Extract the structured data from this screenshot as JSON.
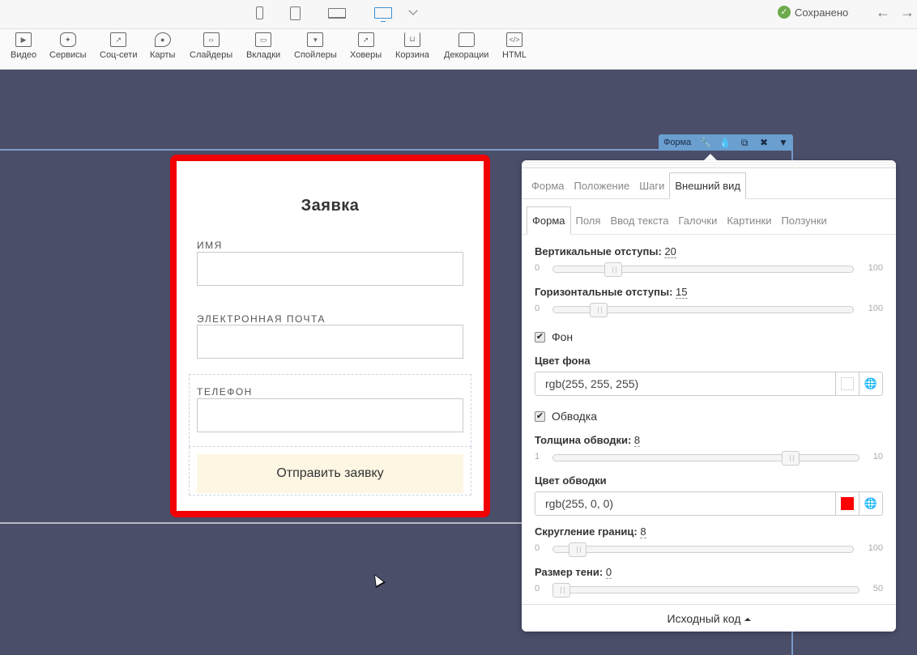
{
  "topbar": {
    "devices": [
      "phone-icon",
      "tablet-icon",
      "laptop-icon",
      "desktop-icon"
    ],
    "active_device": "desktop",
    "saved_label": "Сохранено",
    "accent_color": "#3b8fd6"
  },
  "toolbar": {
    "items": [
      {
        "label": "Видео",
        "icon": "play-icon"
      },
      {
        "label": "Сервисы",
        "icon": "puzzle-icon"
      },
      {
        "label": "Соц-сети",
        "icon": "share-icon"
      },
      {
        "label": "Карты",
        "icon": "map-pin-icon"
      },
      {
        "label": "Слайдеры",
        "icon": "slider-icon"
      },
      {
        "label": "Вкладки",
        "icon": "tabs-icon"
      },
      {
        "label": "Спойлеры",
        "icon": "spoiler-icon"
      },
      {
        "label": "Ховеры",
        "icon": "hover-icon"
      },
      {
        "label": "Корзина",
        "icon": "cart-icon"
      },
      {
        "label": "Декорации",
        "icon": "speech-bubble-icon"
      },
      {
        "label": "HTML",
        "icon": "code-icon"
      }
    ]
  },
  "formbar": {
    "label": "Форма"
  },
  "form": {
    "title": "Заявка",
    "name_label": "ИМЯ",
    "email_label": "ЭЛЕКТРОННАЯ ПОЧТА",
    "phone_label": "ТЕЛЕФОН",
    "submit_label": "Отправить заявку",
    "border_color": "#ff0000",
    "button_bg": "#fdf6e3"
  },
  "panel": {
    "tabs": [
      "Форма",
      "Положение",
      "Шаги",
      "Внешний вид"
    ],
    "active_tab": "Внешний вид",
    "subtabs": [
      "Форма",
      "Поля",
      "Ввод текста",
      "Галочки",
      "Картинки",
      "Ползунки"
    ],
    "active_subtab": "Форма",
    "vertical_padding": {
      "label": "Вертикальные отступы",
      "value": "20",
      "min": "0",
      "max": "100"
    },
    "horizontal_padding": {
      "label": "Горизонтальные отступы",
      "value": "15",
      "min": "0",
      "max": "100"
    },
    "background_checkbox": {
      "label": "Фон",
      "checked": true
    },
    "background_color": {
      "label": "Цвет фона",
      "value": "rgb(255, 255, 255)",
      "swatch": "#ffffff"
    },
    "border_checkbox": {
      "label": "Обводка",
      "checked": true
    },
    "border_width": {
      "label": "Толщина обводки",
      "value": "8",
      "min": "1",
      "max": "10"
    },
    "border_color": {
      "label": "Цвет обводки",
      "value": "rgb(255, 0, 0)",
      "swatch": "#ff0000"
    },
    "border_radius": {
      "label": "Скругление границ",
      "value": "8",
      "min": "0",
      "max": "100"
    },
    "shadow_size": {
      "label": "Размер тени",
      "value": "0",
      "min": "0",
      "max": "50"
    },
    "footer_label": "Исходный код"
  }
}
